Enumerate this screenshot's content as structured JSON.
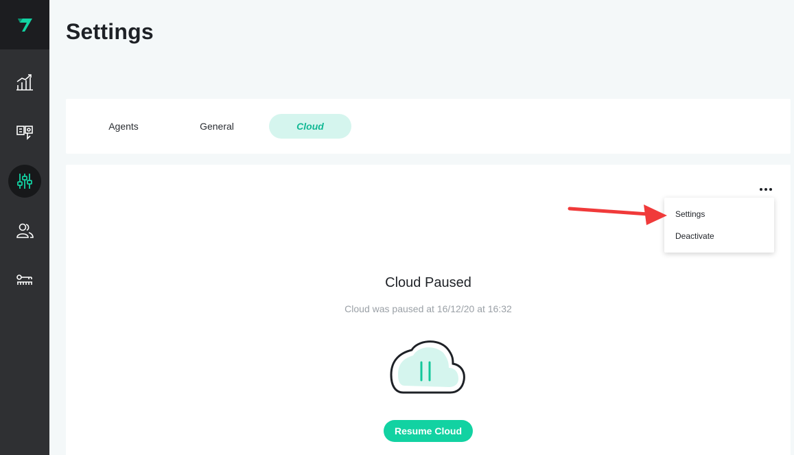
{
  "sidebar": {
    "logo": "brand-logo",
    "items": [
      {
        "icon": "analytics-icon"
      },
      {
        "icon": "tickets-icon"
      },
      {
        "icon": "settings-sliders-icon",
        "active": true
      },
      {
        "icon": "users-icon"
      },
      {
        "icon": "api-key-icon"
      }
    ]
  },
  "page": {
    "title": "Settings"
  },
  "tabs": [
    {
      "label": "Agents"
    },
    {
      "label": "General"
    },
    {
      "label": "Cloud",
      "active": true
    }
  ],
  "menu": {
    "items": [
      {
        "label": "Settings"
      },
      {
        "label": "Deactivate"
      }
    ]
  },
  "cloud": {
    "status_title": "Cloud Paused",
    "status_sub": "Cloud was paused at 16/12/20 at 16:32",
    "resume_label": "Resume Cloud"
  },
  "colors": {
    "accent": "#12d2a2",
    "accent_light": "#d5f5ee",
    "sidebar_bg": "#2f3033",
    "annotation_arrow": "#f03a3a"
  }
}
